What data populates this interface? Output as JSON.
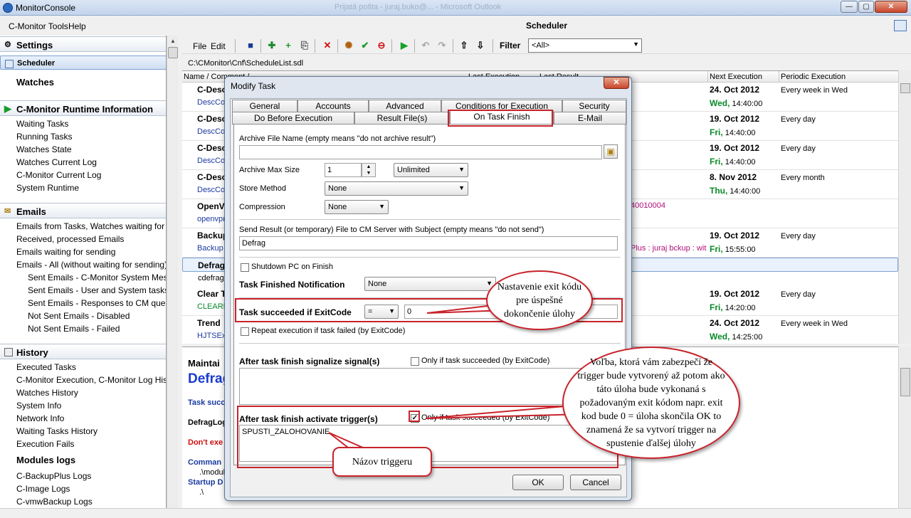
{
  "window": {
    "title": "MonitorConsole",
    "ghost_title": "Prijatá pošta - juraj.buko@...  -  Microsoft Outlook",
    "min": "—",
    "max": "▢",
    "close": "✕"
  },
  "menu": {
    "tools": "C-Monitor Tools",
    "help": "Help"
  },
  "sidebar": {
    "settings": "Settings",
    "scheduler": "Scheduler",
    "watches": "Watches",
    "runtime": "C-Monitor Runtime Information",
    "runtime_items": [
      "Waiting Tasks",
      "Running Tasks",
      "Watches State",
      "Watches Current Log",
      "C-Monitor Current Log",
      "System Runtime"
    ],
    "emails": "Emails",
    "email_items": [
      "Emails from Tasks, Watches waiting for send",
      "Received, processed Emails",
      "Emails waiting for sending",
      "Emails - All (without waiting for sending)"
    ],
    "email_sub_items": [
      "Sent Emails - C-Monitor System Message",
      "Sent Emails - User and System tasks Res",
      "Sent Emails - Responses to CM queries",
      "Not Sent Emails - Disabled",
      "Not Sent Emails - Failed"
    ],
    "history": "History",
    "history_items": [
      "Executed Tasks",
      "C-Monitor Execution, C-Monitor Log History",
      "Watches History",
      "System Info",
      "Network Info",
      "Waiting Tasks History",
      "Execution Fails"
    ],
    "modules": "Modules logs",
    "module_items": [
      "C-BackupPlus Logs",
      "C-Image Logs",
      "C-vmwBackup Logs"
    ]
  },
  "main": {
    "header": "Scheduler",
    "file": "File",
    "edit": "Edit",
    "filter_label": "Filter",
    "filter_value": "<All>",
    "path": "C:\\CMonitor\\Cnf\\ScheduleList.sdl"
  },
  "grid": {
    "columns": [
      "Name / Comment / ...",
      "Last Execution",
      "Last Result",
      "Next Execution",
      "Periodic Execution"
    ],
    "rows": [
      {
        "name": "C-Desc",
        "desc": "DescCo",
        "d1": "24. Oct 2012",
        "day": "Wed,",
        "time": "14:40:00",
        "period": "Every week in Wed"
      },
      {
        "name": "C-Desc",
        "desc": "DescCo",
        "d1": "19. Oct 2012",
        "day": "Fri,",
        "time": "14:40:00",
        "period": "Every day"
      },
      {
        "name": "C-Desc",
        "desc": "DescCo",
        "d1": "19. Oct 2012",
        "day": "Fri,",
        "time": "14:40:00",
        "period": "Every day"
      },
      {
        "name": "C-Desc",
        "desc": "DescCo",
        "d1": "8. Nov 2012",
        "day": "Thu,",
        "time": "14:40:00",
        "period": "Every month"
      },
      {
        "name": "OpenVP",
        "desc": "openvpn",
        "extra": "40010004"
      },
      {
        "name": "Backup",
        "desc": "Backup",
        "d1": "19. Oct 2012",
        "day": "Fri,",
        "time": "15:55:00",
        "period": "Every day",
        "extra2": "Plus : juraj bckup : wit"
      },
      {
        "name": "Defrag",
        "desc": "cdefrag."
      },
      {
        "name": "Clear T",
        "desc": "CLEARD",
        "d1": "19. Oct 2012",
        "day": "Fri,",
        "time": "14:20:00",
        "period": "Every day"
      },
      {
        "name": "Trend",
        "desc": "HJTSEx",
        "d1": "24. Oct 2012",
        "day": "Wed,",
        "time": "14:25:00",
        "period": "Every week in Wed"
      }
    ]
  },
  "details": {
    "title": "Maintai",
    "name": "Defrag",
    "task_succ": "Task succ",
    "defrag_log": "DefragLog",
    "dont_exec": "Don't exe",
    "command": "Comman",
    "cmd_value": ".\\module",
    "startup": "Startup D",
    "startup_value": ".\\"
  },
  "dialog": {
    "title": "Modify Task",
    "tabs_row1": [
      "General",
      "Accounts",
      "Advanced",
      "Conditions for Execution",
      "Security"
    ],
    "tabs_row2": [
      "Do Before Execution",
      "Result File(s)",
      "On Task Finish",
      "E-Mail"
    ],
    "archive_label": "Archive File Name (empty means \"do not archive result\")",
    "archive_value": "",
    "archive_max_label": "Archive Max Size",
    "archive_max_value": "1",
    "archive_max_unit": "Unlimited",
    "store_method_label": "Store Method",
    "store_method_value": "None",
    "compression_label": "Compression",
    "compression_value": "None",
    "send_result_label": "Send Result (or temporary) File to CM Server with Subject (empty means \"do not send\")",
    "send_result_value": "Defrag",
    "shutdown_label": "Shutdown PC on Finish",
    "notification_label": "Task Finished Notification",
    "notification_value": "None",
    "exitcode_label": "Task succeeded if ExitCode",
    "exitcode_op": "=",
    "exitcode_value": "0",
    "repeat_label": "Repeat execution if task failed (by ExitCode)",
    "signal_label": "After task finish signalize signal(s)",
    "signal_only_label": "Only if task succeeded (by ExitCode)",
    "signal_value": "",
    "trigger_label": "After task finish activate trigger(s)",
    "trigger_only_label": "Only if task succeeded (by ExitCode)",
    "trigger_value": "SPUSTI_ZALOHOVANIE",
    "ok": "OK",
    "cancel": "Cancel",
    "close": "✕"
  },
  "annotations": {
    "exitcode_note": [
      "Nastavenie exit kódu",
      "pre úspešné",
      "dokončenie úlohy"
    ],
    "trigger_note": [
      "Voľba, ktorá vám zabezpečí že",
      "trigger bude vytvorený až potom ako",
      "táto úloha bude vykonaná s",
      "požadovaným exit kódom napr. exit",
      "kod bude 0 = úloha skončila OK to",
      "znamená že sa vytvorí trigger na",
      "spustenie ďalšej úlohy"
    ],
    "name_note": "Názov triggeru",
    "accent": "#c8232b"
  }
}
